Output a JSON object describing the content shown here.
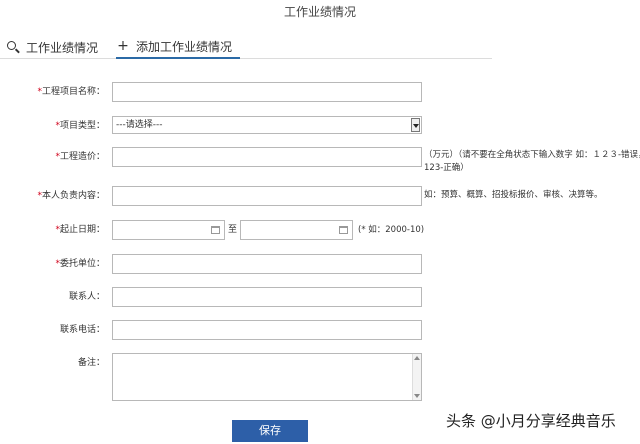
{
  "page": {
    "title": "工作业绩情况"
  },
  "tabs": [
    {
      "label": "工作业绩情况",
      "icon": "search-icon"
    },
    {
      "label": "添加工作业绩情况",
      "icon": "plus-icon",
      "active": true
    }
  ],
  "form": {
    "project_name": {
      "required_mark": "*",
      "label": "工程项目名称：",
      "value": ""
    },
    "project_type": {
      "required_mark": "*",
      "label": "项目类型：",
      "selected": "---请选择---"
    },
    "project_cost": {
      "required_mark": "*",
      "label": "工程造价：",
      "value": "",
      "hint_line1": "（万元）（请不要在全角状态下输入数字 如：１２３-错误，",
      "hint_line2": "123-正确）"
    },
    "responsibility": {
      "required_mark": "*",
      "label": "本人负责内容：",
      "value": "",
      "hint": "如：预算、概算、招投标报价、审核、决算等。"
    },
    "date_range": {
      "required_mark": "*",
      "label": "起止日期：",
      "start": "",
      "end": "",
      "separator": "至",
      "hint": "(* 如：2000-10)"
    },
    "client": {
      "required_mark": "*",
      "label": "委托单位：",
      "value": ""
    },
    "contact": {
      "label": "联系人：",
      "value": ""
    },
    "phone": {
      "label": "联系电话：",
      "value": ""
    },
    "remark": {
      "label": "备注：",
      "value": ""
    }
  },
  "actions": {
    "save_label": "保存"
  },
  "watermark": {
    "text": "头条 @小月分享经典音乐"
  },
  "colors": {
    "required": "#d0021b",
    "button": "#2d5fa8",
    "active_tab": "#2b6aa6"
  }
}
